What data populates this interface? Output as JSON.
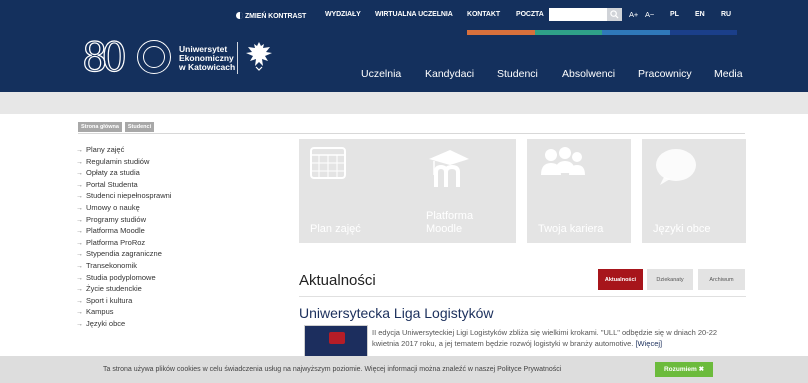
{
  "topbar": {
    "contrast": "ZMIEŃ KONTRAST",
    "items": [
      "WYDZIAŁY",
      "WIRTUALNA UCZELNIA",
      "KONTAKT",
      "POCZTA"
    ],
    "search_placeholder": "",
    "font_up": "A+",
    "font_down": "A−",
    "lang_pl": "PL",
    "lang_en": "EN",
    "lang_ru": "RU",
    "stripe_colors": [
      "#d8703c",
      "#2fa188",
      "#2f78b9",
      "#1b3f8a"
    ]
  },
  "header": {
    "logo_80": "80",
    "uni_line1": "Uniwersytet",
    "uni_line2": "Ekonomiczny",
    "uni_line3": "w Katowicach",
    "nav": [
      "Uczelnia",
      "Kandydaci",
      "Studenci",
      "Absolwenci",
      "Pracownicy",
      "Media"
    ]
  },
  "breadcrumb": [
    "Strona główna",
    "Studenci"
  ],
  "sidebar": [
    "Plany zajęć",
    "Regulamin studiów",
    "Opłaty za studia",
    "Portal Studenta",
    "Studenci niepełnosprawni",
    "Umowy o naukę",
    "Programy studiów",
    "Platforma Moodle",
    "Platforma ProRoz",
    "Stypendia zagraniczne",
    "Transekonomik",
    "Studia podyplomowe",
    "Życie studenckie",
    "Sport i kultura",
    "Kampus",
    "Języki obce"
  ],
  "tiles": [
    {
      "label": "Plan zajęć",
      "icon": "calendar-icon"
    },
    {
      "label": "Platforma\nMoodle",
      "icon": "moodle-icon"
    },
    {
      "label": "Twoja kariera",
      "icon": "people-icon"
    },
    {
      "label": "Języki obce",
      "icon": "speech-bubble-icon"
    }
  ],
  "news": {
    "title": "Aktualności",
    "tabs": [
      "Aktualności",
      "Dziekanaty",
      "Archiwum"
    ],
    "article_title": "Uniwersytecka Liga Logistyków",
    "article_text": "II edycja Uniwersyteckiej Ligi Logistyków zbliża się wielkimi krokami. \"ULL\" odbędzie się w dniach 20-22 kwietnia 2017 roku, a jej tematem będzie rozwój logistyki w branży automotive.",
    "article_more": "[Więcej]"
  },
  "cookie": {
    "text": "Ta strona używa plików cookies w celu świadczenia usług na najwyższym poziomie. Więcej informacji można znaleźć w naszej Polityce Prywatności",
    "button": "Rozumiem ✖"
  },
  "colors": {
    "navy": "#14305d",
    "tile_grey": "#e4e4e4",
    "accent_red": "#a7151b",
    "cookie_green": "#6cbb3c"
  }
}
